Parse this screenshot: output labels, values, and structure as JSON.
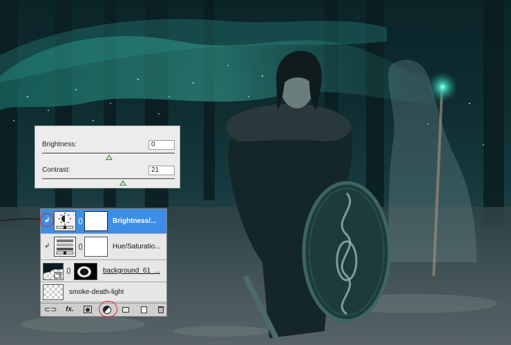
{
  "brightness_contrast": {
    "brightness_label": "Brightness:",
    "brightness_value": "0",
    "contrast_label": "Contrast:",
    "contrast_value": "21"
  },
  "layers": {
    "rows": [
      {
        "name": "Brightness/...",
        "type": "adjustment-brightness",
        "selected": true,
        "clipped": true
      },
      {
        "name": "Hue/Saturatio...",
        "type": "adjustment-hue-saturation",
        "selected": false,
        "clipped": true
      },
      {
        "name": "background_61_...",
        "type": "smart-object",
        "selected": false,
        "clipped": false
      },
      {
        "name": "smoke-death-light",
        "type": "pixel",
        "selected": false,
        "clipped": false
      }
    ],
    "toolbar": {
      "link_icon": "link-icon",
      "fx_label": "fx.",
      "mask_icon": "add-mask-icon",
      "adjustment_icon": "new-adjustment-layer-icon",
      "group_icon": "new-group-icon",
      "new_layer_icon": "new-layer-icon",
      "trash_icon": "trash-icon"
    }
  },
  "colors": {
    "selection_blue": "#3d8ee6",
    "highlight_ring": "#e0262b",
    "slider_thumb": "#3d8a3d"
  }
}
